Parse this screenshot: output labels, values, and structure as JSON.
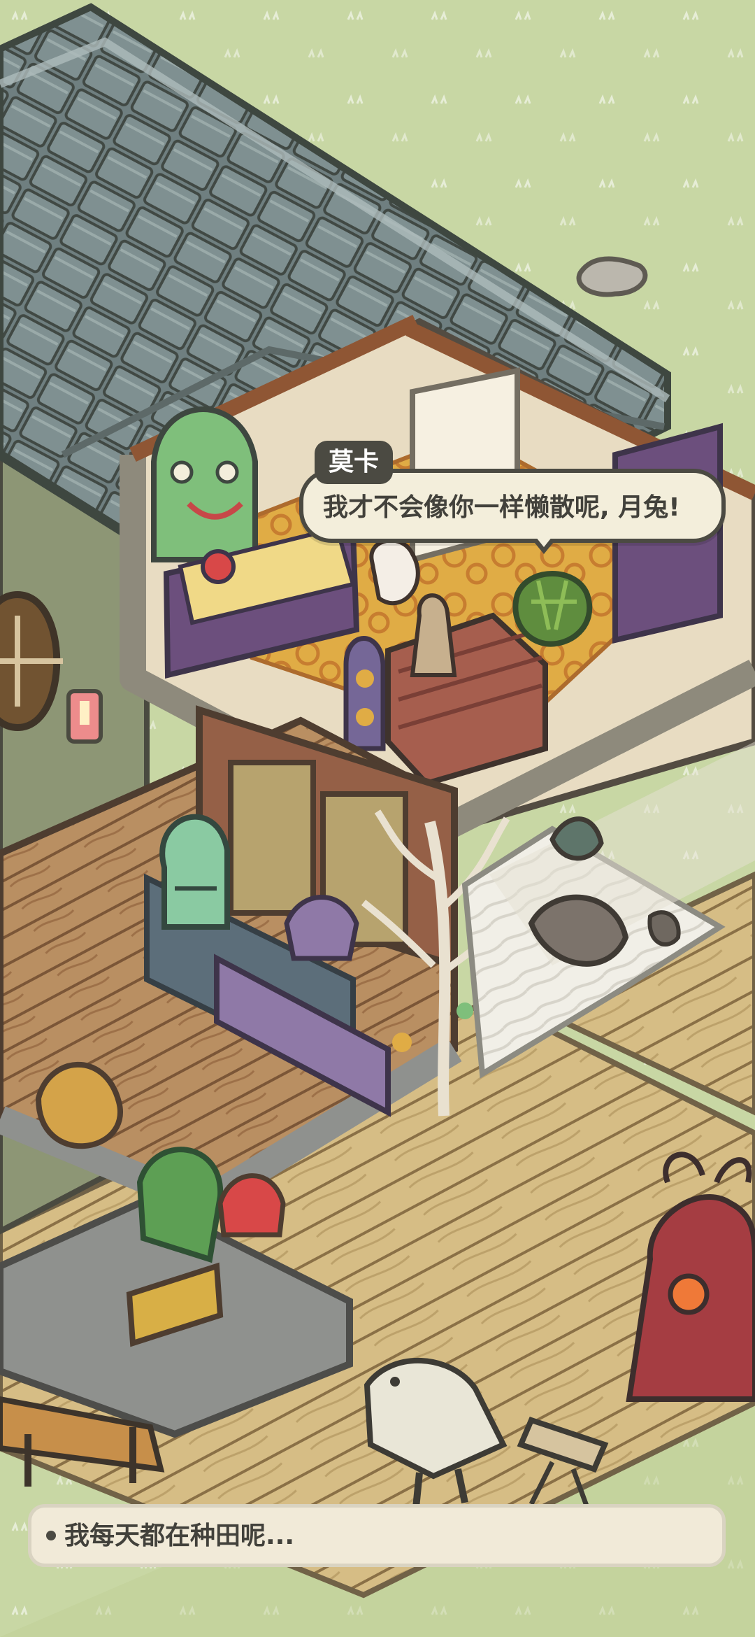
{
  "dialogue": {
    "speaker": "莫卡",
    "line": "我才不会像你一样懒散呢, 月兔!"
  },
  "status_text": "我每天都在种田呢..."
}
